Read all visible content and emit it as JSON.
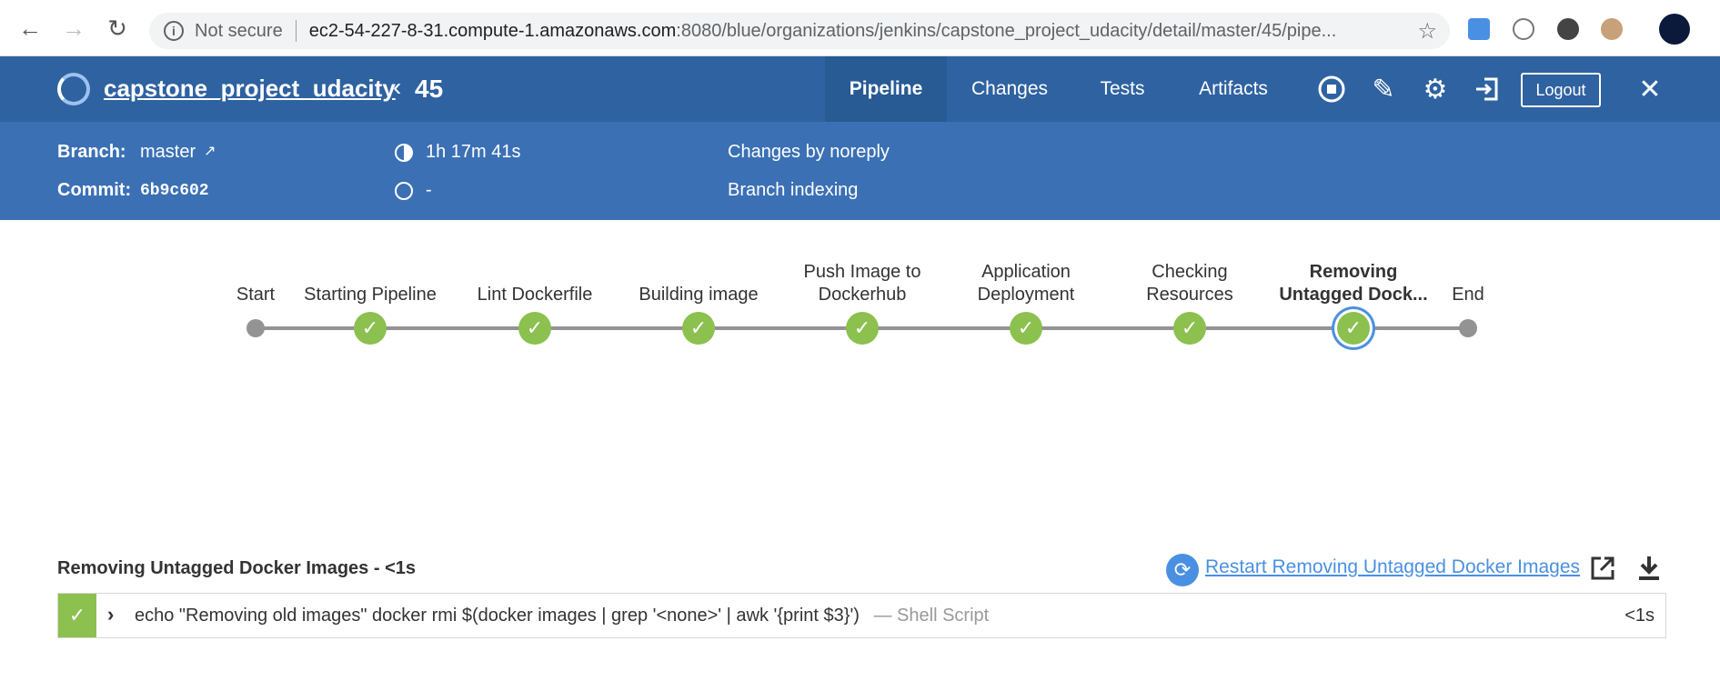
{
  "browser": {
    "security_label": "Not secure",
    "url_host": "ec2-54-227-8-31.compute-1.amazonaws.com",
    "url_path": ":8080/blue/organizations/jenkins/capstone_project_udacity/detail/master/45/pipe..."
  },
  "header": {
    "project_name": "capstone_project_udacity",
    "run_number": "45",
    "tabs": [
      "Pipeline",
      "Changes",
      "Tests",
      "Artifacts"
    ],
    "logout_label": "Logout"
  },
  "run_info": {
    "branch_label": "Branch:",
    "branch_value": "master",
    "commit_label": "Commit:",
    "commit_value": "6b9c602",
    "duration": "1h 17m 41s",
    "ended": "-",
    "changes": "Changes by noreply",
    "cause": "Branch indexing"
  },
  "pipeline": {
    "stages": [
      {
        "line1": "",
        "line2": "Start",
        "status": "start"
      },
      {
        "line1": "",
        "line2": "Starting Pipeline",
        "status": "success"
      },
      {
        "line1": "",
        "line2": "Lint Dockerfile",
        "status": "success"
      },
      {
        "line1": "",
        "line2": "Building image",
        "status": "success"
      },
      {
        "line1": "Push Image to",
        "line2": "Dockerhub",
        "status": "success"
      },
      {
        "line1": "Application",
        "line2": "Deployment",
        "status": "success"
      },
      {
        "line1": "Checking",
        "line2": "Resources",
        "status": "success"
      },
      {
        "line1": "Removing",
        "line2": "Untagged Dock...",
        "status": "success",
        "selected": true
      },
      {
        "line1": "",
        "line2": "End",
        "status": "end"
      }
    ]
  },
  "step": {
    "title": "Removing Untagged Docker Images - <1s",
    "restart_label": "Restart Removing Untagged Docker Images",
    "log": {
      "command": "echo \"Removing old images\" docker rmi $(docker images | grep '<none>' | awk '{print $3}')",
      "type": "— Shell Script",
      "duration": "<1s"
    }
  },
  "colors": {
    "header_bg": "#2f62a1",
    "subheader_bg": "#3b70b5",
    "success": "#8cc04f",
    "link": "#4a90e2"
  }
}
